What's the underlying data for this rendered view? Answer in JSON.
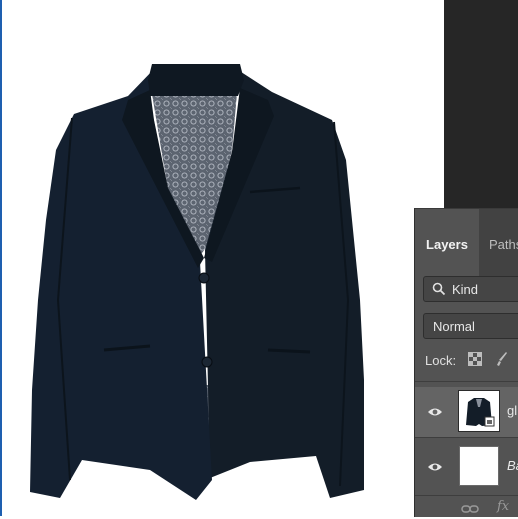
{
  "colors": {
    "jacket": "#131d28",
    "lining": "#5c6470",
    "workspace": "#262626",
    "panel": "#535353",
    "selected_row": "#646464",
    "canvas_border": "#1e5fb0"
  },
  "canvas": {
    "image_subject": "navy blazer jacket"
  },
  "layers_panel": {
    "tabs": [
      {
        "label": "Layers",
        "active": true
      },
      {
        "label": "Paths",
        "active": false
      }
    ],
    "filter": {
      "icon": "search-icon",
      "label": "Kind"
    },
    "blend_mode": "Normal",
    "lock_label": "Lock:",
    "layers": [
      {
        "name": "gl",
        "visible": true,
        "selected": true,
        "thumbnail": "jacket"
      },
      {
        "name": "Ba",
        "visible": true,
        "selected": false,
        "thumbnail": "white"
      }
    ],
    "footer_icons": [
      "link-icon",
      "fx-icon"
    ],
    "fx_label": "fx"
  }
}
